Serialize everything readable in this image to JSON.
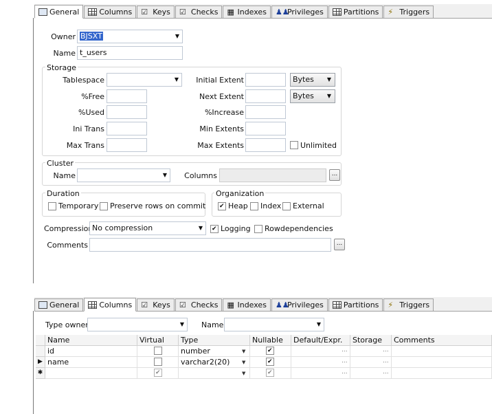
{
  "top": {
    "tabs": [
      {
        "label": "General",
        "icon": "general-icon",
        "active": true
      },
      {
        "label": "Columns",
        "icon": "columns-icon"
      },
      {
        "label": "Keys",
        "icon": "keys-icon"
      },
      {
        "label": "Checks",
        "icon": "checks-icon"
      },
      {
        "label": "Indexes",
        "icon": "indexes-icon"
      },
      {
        "label": "Privileges",
        "icon": "privileges-icon"
      },
      {
        "label": "Partitions",
        "icon": "partitions-icon"
      },
      {
        "label": "Triggers",
        "icon": "triggers-icon"
      }
    ],
    "owner_label": "Owner",
    "owner_value": "BJSXT",
    "name_label": "Name",
    "name_value": "t_users",
    "storage": {
      "title": "Storage",
      "tablespace_label": "Tablespace",
      "free_label": "%Free",
      "used_label": "%Used",
      "ini_trans_label": "Ini Trans",
      "max_trans_label": "Max Trans",
      "initial_extent_label": "Initial Extent",
      "next_extent_label": "Next Extent",
      "increase_label": "%Increase",
      "min_extents_label": "Min Extents",
      "max_extents_label": "Max Extents",
      "initial_unit": "Bytes",
      "next_unit": "Bytes",
      "unlimited_label": "Unlimited"
    },
    "cluster": {
      "title": "Cluster",
      "name_label": "Name",
      "columns_label": "Columns",
      "ellipsis": "..."
    },
    "duration": {
      "title": "Duration",
      "temporary_label": "Temporary",
      "preserve_label": "Preserve rows on commit"
    },
    "organization": {
      "title": "Organization",
      "heap_label": "Heap",
      "index_label": "Index",
      "external_label": "External"
    },
    "compression_label": "Compression",
    "compression_value": "No compression",
    "logging_label": "Logging",
    "rowdependencies_label": "Rowdependencies",
    "comments_label": "Comments",
    "comments_ellipsis": "..."
  },
  "bottom": {
    "tabs": [
      {
        "label": "General",
        "icon": "general-icon"
      },
      {
        "label": "Columns",
        "icon": "columns-icon",
        "active": true
      },
      {
        "label": "Keys",
        "icon": "keys-icon"
      },
      {
        "label": "Checks",
        "icon": "checks-icon"
      },
      {
        "label": "Indexes",
        "icon": "indexes-icon"
      },
      {
        "label": "Privileges",
        "icon": "privileges-icon"
      },
      {
        "label": "Partitions",
        "icon": "partitions-icon"
      },
      {
        "label": "Triggers",
        "icon": "triggers-icon"
      }
    ],
    "type_owner_label": "Type owner",
    "name_label": "Name",
    "headers": [
      "Name",
      "Virtual",
      "Type",
      "Nullable",
      "Default/Expr.",
      "Storage",
      "Comments"
    ],
    "rows": [
      {
        "name": "id",
        "virtual": false,
        "type": "number",
        "nullable": true,
        "marker": ""
      },
      {
        "name": "name",
        "virtual": false,
        "type": "varchar2(20)",
        "nullable": true,
        "marker": "▶"
      },
      {
        "name": "",
        "virtual": true,
        "type": "",
        "nullable": true,
        "marker": "✱"
      }
    ],
    "cell_ellipsis": "..."
  }
}
